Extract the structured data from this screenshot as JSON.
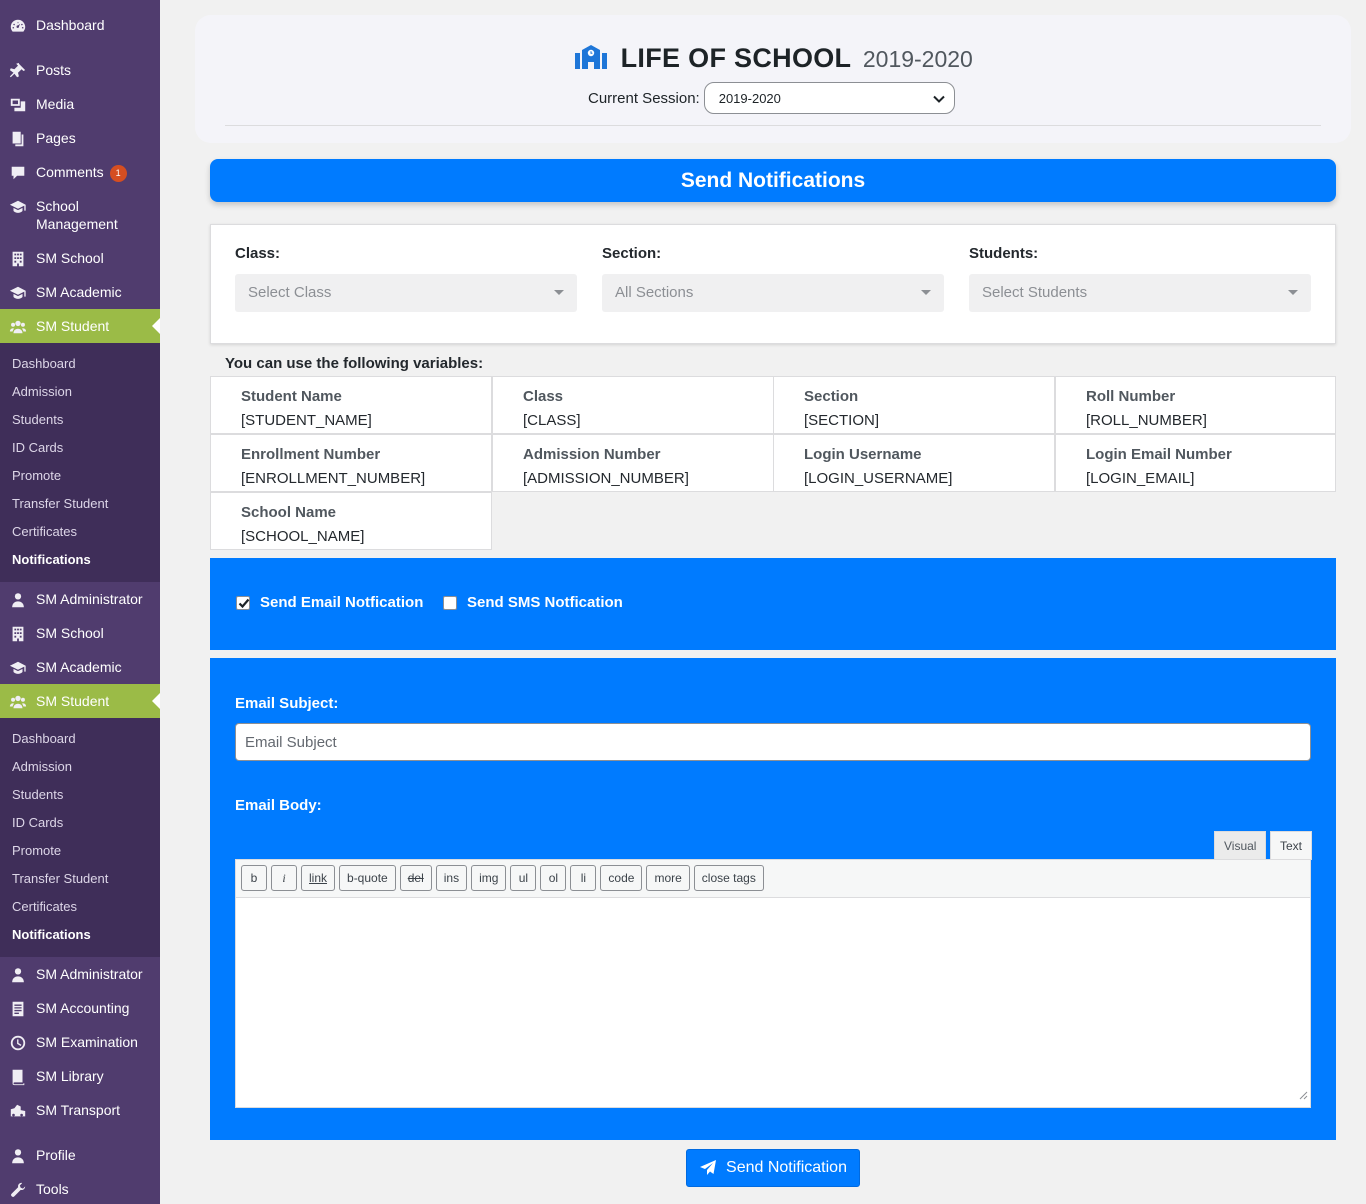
{
  "sidebar": {
    "main_top": [
      {
        "label": "Dashboard",
        "icon": "dashboard-icon"
      },
      {
        "label": "Posts",
        "icon": "pin-icon"
      },
      {
        "label": "Media",
        "icon": "media-icon"
      },
      {
        "label": "Pages",
        "icon": "pages-icon"
      },
      {
        "label": "Comments",
        "icon": "comments-icon",
        "badge": "1"
      },
      {
        "label": "School Management",
        "icon": "graduation-cap-icon"
      },
      {
        "label": "SM School",
        "icon": "building-icon"
      },
      {
        "label": "SM Academic",
        "icon": "graduation-cap-icon"
      },
      {
        "label": "SM Student",
        "icon": "users-icon",
        "active": true
      }
    ],
    "submenu_items": [
      "Dashboard",
      "Admission",
      "Students",
      "ID Cards",
      "Promote",
      "Transfer Student",
      "Certificates",
      "Notifications"
    ],
    "middle": [
      {
        "label": "SM Administrator",
        "icon": "user-icon"
      },
      {
        "label": "SM School",
        "icon": "building-icon"
      },
      {
        "label": "SM Academic",
        "icon": "graduation-cap-icon"
      },
      {
        "label": "SM Student",
        "icon": "users-icon",
        "active": true
      }
    ],
    "bottom": [
      {
        "label": "SM Administrator",
        "icon": "user-icon"
      },
      {
        "label": "SM Accounting",
        "icon": "ledger-icon"
      },
      {
        "label": "SM Examination",
        "icon": "clock-icon"
      },
      {
        "label": "SM Library",
        "icon": "book-icon"
      },
      {
        "label": "SM Transport",
        "icon": "transport-icon"
      },
      {
        "label": "Profile",
        "icon": "user-icon"
      },
      {
        "label": "Tools",
        "icon": "wrench-icon"
      }
    ]
  },
  "header": {
    "title": "LIFE OF SCHOOL",
    "year": "2019-2020",
    "session_label": "Current Session:",
    "session_value": "2019-2020"
  },
  "banner": {
    "title": "Send Notifications"
  },
  "filters": {
    "class": {
      "label": "Class:",
      "placeholder": "Select Class"
    },
    "section": {
      "label": "Section:",
      "placeholder": "All Sections"
    },
    "students": {
      "label": "Students:",
      "placeholder": "Select Students"
    }
  },
  "variables": {
    "heading": "You can use the following variables:",
    "items": [
      {
        "name": "Student Name",
        "code": "[STUDENT_NAME]"
      },
      {
        "name": "Class",
        "code": "[CLASS]"
      },
      {
        "name": "Section",
        "code": "[SECTION]"
      },
      {
        "name": "Roll Number",
        "code": "[ROLL_NUMBER]"
      },
      {
        "name": "Enrollment Number",
        "code": "[ENROLLMENT_NUMBER]"
      },
      {
        "name": "Admission Number",
        "code": "[ADMISSION_NUMBER]"
      },
      {
        "name": "Login Username",
        "code": "[LOGIN_USERNAME]"
      },
      {
        "name": "Login Email Number",
        "code": "[LOGIN_EMAIL]"
      },
      {
        "name": "School Name",
        "code": "[SCHOOL_NAME]"
      }
    ]
  },
  "notification_types": {
    "email": {
      "label": "Send Email Notfication",
      "checked": true
    },
    "sms": {
      "label": "Send SMS Notfication",
      "checked": false
    }
  },
  "email": {
    "subject_label": "Email Subject:",
    "subject_placeholder": "Email Subject",
    "body_label": "Email Body:",
    "tab_visual": "Visual",
    "tab_text": "Text",
    "toolbar": [
      "b",
      "i",
      "link",
      "b-quote",
      "del",
      "ins",
      "img",
      "ul",
      "ol",
      "li",
      "code",
      "more",
      "close tags"
    ]
  },
  "submit": {
    "label": "Send Notification"
  },
  "colors": {
    "primary": "#007bff",
    "sidebar": "#503c6e",
    "submenu": "#3f2e59",
    "active": "#9bbb47"
  }
}
